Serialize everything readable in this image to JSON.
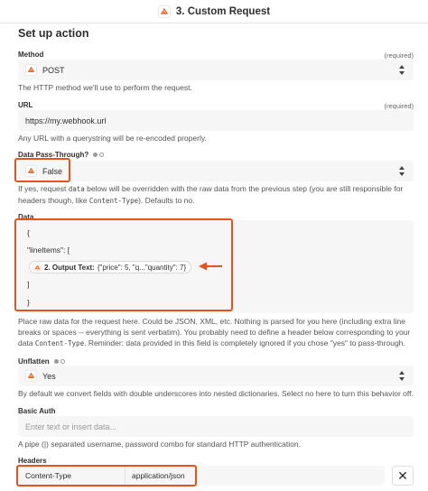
{
  "header": {
    "title": "3. Custom Request"
  },
  "section_title": "Set up action",
  "method": {
    "label": "Method",
    "required": "(required)",
    "value": "POST",
    "help": "The HTTP method we'll use to perform the request."
  },
  "url": {
    "label": "URL",
    "required": "(required)",
    "value": "https://my.webhook.url",
    "help": "Any URL with a querystring will be re-encoded properly."
  },
  "passthrough": {
    "label": "Data Pass-Through?",
    "value": "False",
    "help_1": "If yes, request ",
    "help_code_1": "data",
    "help_2": " below will be overridden with the raw data from the previous step (you are still responsible for headers though, like ",
    "help_code_2": "Content-Type",
    "help_3": "). Defaults to no."
  },
  "data": {
    "label": "Data",
    "line_1": "{",
    "line_2": "\"lineItems\": [",
    "pill_step": "2. Output Text:",
    "pill_value": "{\"price\": 5, \"q...\"quantity\": 7}",
    "line_4": "]",
    "line_5": "}",
    "help_1": "Place raw data for the request here. Could be JSON, XML, etc. Nothing is parsed for you here (including extra line breaks or spaces -- everything is sent verbatim). You probably need to define a header below corresponding to your data ",
    "help_code": "Content-Type",
    "help_2": ". Reminder: data provided in this field is completely ignored if you chose \"yes\" to pass-through."
  },
  "unflatten": {
    "label": "Unflatten",
    "value": "Yes",
    "help": "By default we convert fields with double underscores into nested dictionaries. Select no here to turn this behavior off."
  },
  "basic_auth": {
    "label": "Basic Auth",
    "placeholder": "Enter text or insert data...",
    "help": "A pipe (|) separated username, password combo for standard HTTP authentication."
  },
  "headers": {
    "label": "Headers",
    "key": "Content-Type",
    "value": "application/json",
    "remove_glyph": "✕"
  },
  "colors": {
    "highlight": "#e8531d",
    "brand": "#ff4f00"
  }
}
